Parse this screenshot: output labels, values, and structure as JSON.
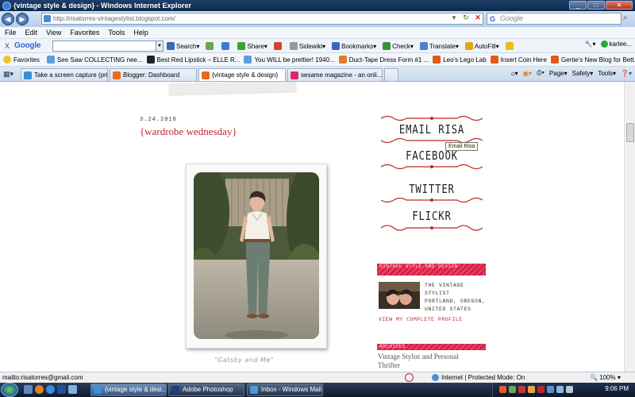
{
  "window": {
    "title": "{vintage style & design} - Windows Internet Explorer",
    "controls": [
      "_",
      "□",
      "✕"
    ]
  },
  "address_bar": {
    "url": "http://risatorres-vintagestylist.blogspot.com/",
    "search_placeholder": "Google",
    "search_logo": "G"
  },
  "menu": [
    "File",
    "Edit",
    "View",
    "Favorites",
    "Tools",
    "Help"
  ],
  "google_toolbar": {
    "close": "X",
    "logo": "Google",
    "items": [
      {
        "label": "Search",
        "icon": "magnifier-icon",
        "color": "#2f6db5"
      },
      {
        "label": "",
        "icon": "pagerank-icon",
        "color": "#6aa84f"
      },
      {
        "label": "",
        "icon": "plus-icon",
        "color": "#3d7ad6"
      },
      {
        "label": "Share",
        "icon": "share-icon",
        "color": "#37a13a"
      },
      {
        "label": "",
        "icon": "popup-blocker-icon",
        "color": "#d5432b"
      },
      {
        "label": "Sidewiki",
        "icon": "sidewiki-icon",
        "color": "#999999"
      },
      {
        "label": "Bookmarks",
        "icon": "star-icon",
        "color": "#3a63c2"
      },
      {
        "label": "Check",
        "icon": "check-icon",
        "color": "#3e8e3e"
      },
      {
        "label": "Translate",
        "icon": "translate-icon",
        "color": "#4c7fd1"
      },
      {
        "label": "AutoFill",
        "icon": "autofill-icon",
        "color": "#e7a316"
      },
      {
        "label": "",
        "icon": "highlighter-icon",
        "color": "#e2c21d"
      }
    ],
    "right_items": [
      "",
      "karlee..."
    ]
  },
  "favorites_bar": {
    "label": "Favorites",
    "items": [
      {
        "label": "See Saw COLLECTING nee...",
        "color": "#5aa0d8"
      },
      {
        "label": "Best Red Lipstick – ELLE R...",
        "color": "#222222"
      },
      {
        "label": "You WILL be prettier! 1940...",
        "color": "#5aa0d8"
      },
      {
        "label": "Duct-Tape Dress Form #1 ...",
        "color": "#e07b2b"
      },
      {
        "label": "Leo's Lego Lab",
        "color": "#e05a1a"
      },
      {
        "label": "Insert Coin Here",
        "color": "#e05a1a"
      },
      {
        "label": "Gertie's New Blog for Bett...",
        "color": "#e05a1a"
      }
    ]
  },
  "tabs": [
    {
      "label": "Take a screen capture (pri...",
      "color": "#3a8edb",
      "active": false
    },
    {
      "label": "Blogger: Dashboard",
      "color": "#e76b1c",
      "active": false
    },
    {
      "label": "{vintage style & design}",
      "color": "#e76b1c",
      "active": true
    },
    {
      "label": "sesame magazine - an onli...",
      "color": "#e0246a",
      "active": false
    }
  ],
  "tab_tools": [
    "Page",
    "Safety",
    "Tools"
  ],
  "post": {
    "date": "3.24.2010",
    "title": "{wardrobe wednesday}",
    "caption": "\"Gatsby and Me\""
  },
  "sidebar": {
    "links": [
      "EMAIL RISA",
      "FACEBOOK",
      "TWITTER",
      "FLICKR"
    ],
    "tooltip": "Email Risa",
    "about_header": "VINTAGE STYLE AND DESIGN",
    "profile_lines": [
      "THE VINTAGE",
      "STYLIST",
      "PORTLAND, OREGON,",
      "UNITED STATES"
    ],
    "view_profile": "VIEW MY COMPLETE PROFILE",
    "second_header": "ARCHIVES",
    "blog_title_line1": "Vintage Stylist and Personal",
    "blog_title_line2": "Thrifter"
  },
  "status_bar": {
    "url": "mailto:risatorres@gmail.com",
    "zone": "Internet | Protected Mode: On",
    "zoom": "100%"
  },
  "taskbar": {
    "buttons": [
      {
        "label": "{vintage style & desi...",
        "color": "#3a8edb",
        "active": true
      },
      {
        "label": "Adobe Photoshop",
        "color": "#1c3f7a",
        "active": false
      },
      {
        "label": "Inbox - Windows Mail",
        "color": "#4a9bd6",
        "active": false
      }
    ],
    "clock": "9:06 PM"
  },
  "colors": {
    "accent_red": "#c0272d",
    "sidebar_pink": "#d81f47"
  }
}
